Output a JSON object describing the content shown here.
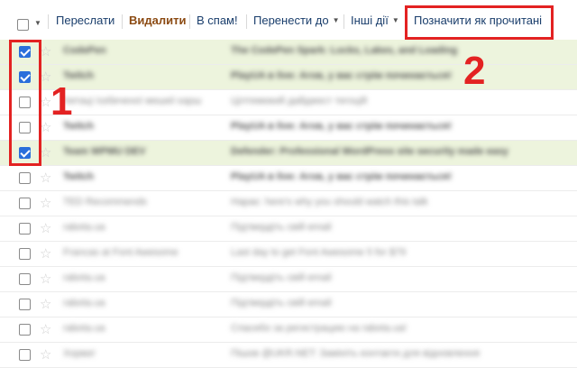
{
  "toolbar": {
    "forward_label": "Переслати",
    "delete_label": "Видалити",
    "spam_label": "В спам!",
    "move_label": "Перенести до",
    "other_label": "Інші дії",
    "mark_read_label": "Позначити як прочитані"
  },
  "icons": {
    "caret": "▼",
    "star": "☆"
  },
  "annotations": {
    "label_1": "1",
    "label_2": "2",
    "color": "#e32222"
  },
  "rows": [
    {
      "sender": "CodePen",
      "subject": "The CodePen Spark: Locks, Lakes, and Loading",
      "checked": true,
      "unread": true
    },
    {
      "sender": "Twitch",
      "subject": "PlayUA в live: Агов, у вас стрім починається!",
      "checked": true,
      "unread": true
    },
    {
      "sender": "Читаці Іззбеченої мешкії карш",
      "subject": "Цілтемкжий дайджест тегоцій",
      "checked": false,
      "unread": false
    },
    {
      "sender": "Twitch",
      "subject": "PlayUA в live: Агов, у вас стрім починається!",
      "checked": false,
      "unread": true
    },
    {
      "sender": "Team WPMU DEV",
      "subject": "Defender: Professional WordPress site security made easy",
      "checked": true,
      "unread": true
    },
    {
      "sender": "Twitch",
      "subject": "PlayUA в live: Агов, у вас стрім починається!",
      "checked": false,
      "unread": true
    },
    {
      "sender": "TED Recommends",
      "subject": "Нарає: here's why you should watch this talk",
      "checked": false,
      "unread": false
    },
    {
      "sender": "rabota.ua",
      "subject": "Підтвердіть свій email",
      "checked": false,
      "unread": false
    },
    {
      "sender": "Francas at Font Awesome",
      "subject": "Last day to get Font Awesome 5 for $79",
      "checked": false,
      "unread": false
    },
    {
      "sender": "rabota.ua",
      "subject": "Підтвердіть свій email",
      "checked": false,
      "unread": false
    },
    {
      "sender": "rabota.ua",
      "subject": "Підтвердіть свій email",
      "checked": false,
      "unread": false
    },
    {
      "sender": "rabota.ua",
      "subject": "Спасибо за регистрацию на rabota.ua!",
      "checked": false,
      "unread": false
    },
    {
      "sender": "Хорват",
      "subject": "Пішов @UKR.NET: Замініть контакти для відновлення",
      "checked": false,
      "unread": false
    }
  ]
}
